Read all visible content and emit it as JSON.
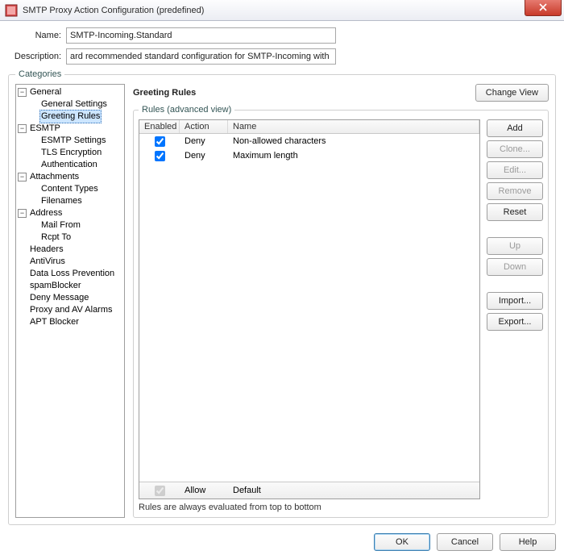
{
  "window": {
    "title": "SMTP Proxy Action Configuration (predefined)"
  },
  "form": {
    "name_label": "Name:",
    "name_value": "SMTP-Incoming.Standard",
    "desc_label": "Description:",
    "desc_value": "ard recommended standard configuration for SMTP-Incoming with logging enabled"
  },
  "categories": {
    "legend": "Categories",
    "tree": {
      "general": {
        "label": "General",
        "settings": "General Settings",
        "greeting": "Greeting Rules"
      },
      "esmtp": {
        "label": "ESMTP",
        "settings": "ESMTP Settings",
        "tls": "TLS Encryption",
        "auth": "Authentication"
      },
      "attach": {
        "label": "Attachments",
        "content": "Content Types",
        "filenames": "Filenames"
      },
      "address": {
        "label": "Address",
        "mailfrom": "Mail From",
        "rcptto": "Rcpt To"
      },
      "headers": "Headers",
      "antivirus": "AntiVirus",
      "dlp": "Data Loss Prevention",
      "spam": "spamBlocker",
      "deny": "Deny Message",
      "alarms": "Proxy and AV Alarms",
      "apt": "APT Blocker"
    }
  },
  "right": {
    "heading": "Greeting Rules",
    "change_view": "Change View",
    "rules_legend": "Rules (advanced view)",
    "columns": {
      "enabled": "Enabled",
      "action": "Action",
      "name": "Name"
    },
    "rows": [
      {
        "enabled": true,
        "action": "Deny",
        "name": "Non-allowed characters"
      },
      {
        "enabled": true,
        "action": "Deny",
        "name": "Maximum length"
      }
    ],
    "default_row": {
      "enabled": true,
      "action": "Allow",
      "name": "Default"
    },
    "eval_note": "Rules are always evaluated from top to bottom",
    "buttons": {
      "add": "Add",
      "clone": "Clone...",
      "edit": "Edit...",
      "remove": "Remove",
      "reset": "Reset",
      "up": "Up",
      "down": "Down",
      "import": "Import...",
      "export": "Export..."
    }
  },
  "dialog": {
    "ok": "OK",
    "cancel": "Cancel",
    "help": "Help"
  }
}
